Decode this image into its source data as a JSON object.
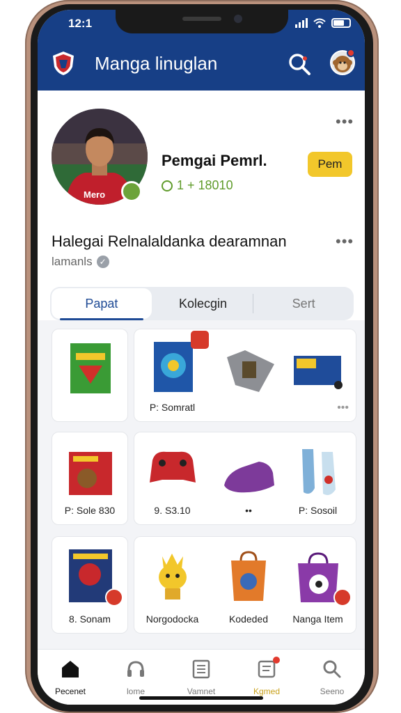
{
  "status": {
    "time": "12:1"
  },
  "header": {
    "title": "Manga linuglan",
    "crest_icon": "shield-crest-icon",
    "search_icon": "search-icon",
    "avatar_icon": "monkey-avatar-icon"
  },
  "profile": {
    "name": "Pemgai Pemrl.",
    "stat": "1 + 18010",
    "follow_label": "Pem",
    "heading": "Halegai Relnalaldanka dearamnan",
    "subheading": "lamanls",
    "tabs": [
      "Papat",
      "Kolecgin",
      "Sert"
    ]
  },
  "grid": {
    "items": [
      {
        "label": "",
        "art": "green-box"
      },
      {
        "label": "P: Somratl",
        "art": "blue-game-box"
      },
      {
        "label": "",
        "art": "grey-backpack"
      },
      {
        "label": "",
        "art": "blue-toy-box"
      },
      {
        "label": "P: Sole 830",
        "art": "red-box"
      },
      {
        "label": "9. S3.10",
        "art": "red-controller"
      },
      {
        "label": "••",
        "art": "purple-shoe"
      },
      {
        "label": "P: Sosoil",
        "art": "blue-socks"
      },
      {
        "label": "8. Sonam",
        "art": "comic-box"
      },
      {
        "label": "Norgodocka",
        "art": "yellow-plush"
      },
      {
        "label": "Kodeded",
        "art": "orange-bag"
      },
      {
        "label": "Nanga Item",
        "art": "purple-bag"
      }
    ]
  },
  "nav": {
    "items": [
      {
        "label": "Pecenet",
        "icon": "home-icon"
      },
      {
        "label": "lome",
        "icon": "headset-icon"
      },
      {
        "label": "Vamnet",
        "icon": "list-icon"
      },
      {
        "label": "Kgmed",
        "icon": "notes-icon"
      },
      {
        "label": "Seeno",
        "icon": "search-icon"
      }
    ]
  },
  "colors": {
    "primary": "#173f86",
    "accent": "#f2c72b",
    "stat": "#5f9b2a"
  }
}
